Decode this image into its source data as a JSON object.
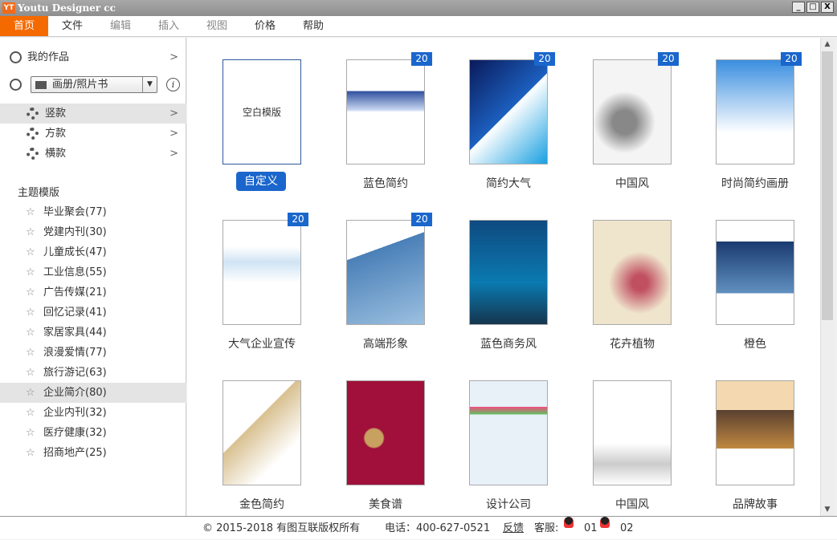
{
  "window": {
    "logo": "YT",
    "title": "Youtu Designer cc",
    "buttons": [
      "_",
      "□",
      "X"
    ]
  },
  "menu": [
    {
      "label": "首页",
      "state": "active"
    },
    {
      "label": "文件"
    },
    {
      "label": "编辑",
      "state": "disabled"
    },
    {
      "label": "插入",
      "state": "disabled"
    },
    {
      "label": "视图",
      "state": "disabled"
    },
    {
      "label": "价格"
    },
    {
      "label": "帮助"
    }
  ],
  "sidebar": {
    "my_works": "我的作品",
    "product_select": "画册/照片书",
    "orientations": [
      "竖款",
      "方款",
      "横款"
    ],
    "selected_orientation": "竖款",
    "section_title": "主题模版",
    "categories": [
      "毕业聚会(77)",
      "党建内刊(30)",
      "儿童成长(47)",
      "工业信息(55)",
      "广告传媒(21)",
      "回忆记录(41)",
      "家居家具(44)",
      "浪漫爱情(77)",
      "旅行游记(63)",
      "企业简介(80)",
      "企业内刊(32)",
      "医疗健康(32)",
      "招商地产(25)"
    ],
    "selected_category": "企业简介(80)"
  },
  "templates": [
    {
      "label": "自定义",
      "thumb_text": "空白模版"
    },
    {
      "label": "蓝色简约",
      "badge": "20"
    },
    {
      "label": "简约大气",
      "badge": "20"
    },
    {
      "label": "中国风",
      "badge": "20"
    },
    {
      "label": "时尚简约画册",
      "badge": "20"
    },
    {
      "label": "大气企业宣传",
      "badge": "20"
    },
    {
      "label": "高端形象",
      "badge": "20"
    },
    {
      "label": "蓝色商务风"
    },
    {
      "label": "花卉植物"
    },
    {
      "label": "橙色"
    },
    {
      "label": "金色简约"
    },
    {
      "label": "美食谱"
    },
    {
      "label": "设计公司"
    },
    {
      "label": "中国风"
    },
    {
      "label": "品牌故事"
    }
  ],
  "footer": {
    "copyright": "© 2015-2018 有图互联版权所有",
    "phone": "电话：400-627-0521",
    "feedback": "反馈",
    "service_label": "客服:",
    "service_1": "01",
    "service_2": "02"
  },
  "colors": {
    "accent": "#f56a00",
    "badge": "#1a66cc"
  }
}
